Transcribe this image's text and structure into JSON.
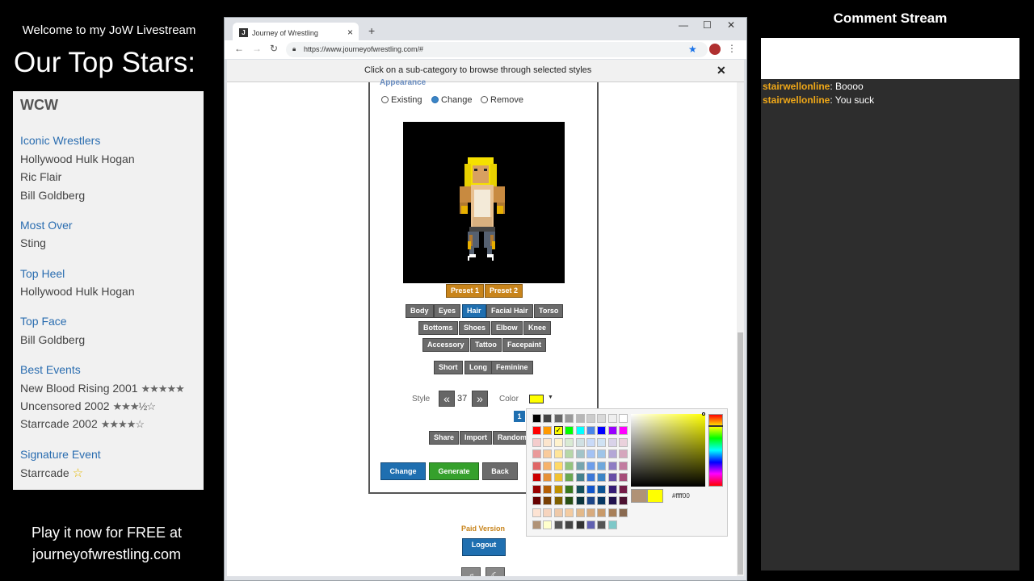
{
  "overlay": {
    "welcome": "Welcome to my JoW Livestream",
    "heading": "Our Top Stars:",
    "play_line1": "Play it now for FREE at",
    "play_line2": "journeyofwrestling.com"
  },
  "wcw": {
    "title": "WCW",
    "sections": [
      {
        "head": "Iconic Wrestlers",
        "items": [
          "Hollywood Hulk Hogan",
          "Ric Flair",
          "Bill Goldberg"
        ]
      },
      {
        "head": "Most Over",
        "items": [
          "Sting"
        ]
      },
      {
        "head": "Top Heel",
        "items": [
          "Hollywood Hulk Hogan"
        ]
      },
      {
        "head": "Top Face",
        "items": [
          "Bill Goldberg"
        ]
      },
      {
        "head": "Best Events",
        "items": [
          "New Blood Rising 2001",
          "Uncensored 2002",
          "Starrcade 2002"
        ],
        "ratings": [
          5,
          3.5,
          4
        ]
      },
      {
        "head": "Signature Event",
        "items": [
          "Starrcade"
        ]
      }
    ]
  },
  "browser": {
    "tab_title": "Journey of Wrestling",
    "favicon": "J",
    "url": "https://www.journeyofwrestling.com/#",
    "banner": "Click on a sub-category to browse through selected styles",
    "close_glyph": "✕"
  },
  "editor": {
    "section_cut": "Appearance",
    "radio": {
      "existing": "Existing",
      "change": "Change",
      "remove": "Remove",
      "selected": "change"
    },
    "presets": [
      "Preset 1",
      "Preset 2"
    ],
    "categories_row1": [
      "Body",
      "Eyes",
      "Hair",
      "Facial Hair",
      "Torso"
    ],
    "categories_row2": [
      "Bottoms",
      "Shoes",
      "Elbow",
      "Knee"
    ],
    "categories_row3": [
      "Accessory",
      "Tattoo",
      "Facepaint"
    ],
    "active_category": "Hair",
    "subcategories": [
      "Short",
      "Long",
      "Feminine"
    ],
    "style_label": "Style",
    "style_value": "37",
    "color_label": "Color",
    "color_value": "#ffff00",
    "page_number": "1",
    "actions": [
      "Share",
      "Import",
      "Randomi"
    ],
    "change_btn": "Change",
    "generate_btn": "Generate",
    "back_btn": "Back",
    "paid_version": "Paid Version",
    "logout": "Logout"
  },
  "picker": {
    "hex": "#ffff00",
    "selected_swatch": "#ffff00",
    "grays": [
      "#000000",
      "#434343",
      "#666666",
      "#999999",
      "#b7b7b7",
      "#cccccc",
      "#d9d9d9",
      "#efefef",
      "#ffffff"
    ],
    "brights": [
      "#ff0000",
      "#ff9900",
      "#ffff00",
      "#00ff00",
      "#00ffff",
      "#4a86e8",
      "#0000ff",
      "#9900ff",
      "#ff00ff"
    ],
    "shades": [
      [
        "#f4cccc",
        "#fce5cd",
        "#fff2cc",
        "#d9ead3",
        "#d0e0e3",
        "#c9daf8",
        "#cfe2f3",
        "#d9d2e9",
        "#ead1dc"
      ],
      [
        "#ea9999",
        "#f9cb9c",
        "#ffe599",
        "#b6d7a8",
        "#a2c4c9",
        "#a4c2f4",
        "#9fc5e8",
        "#b4a7d6",
        "#d5a6bd"
      ],
      [
        "#e06666",
        "#f6b26b",
        "#ffd966",
        "#93c47d",
        "#76a5af",
        "#6d9eeb",
        "#6fa8dc",
        "#8e7cc3",
        "#c27ba0"
      ],
      [
        "#cc0000",
        "#e69138",
        "#f1c232",
        "#6aa84f",
        "#45818e",
        "#3c78d8",
        "#3d85c6",
        "#674ea7",
        "#a64d79"
      ],
      [
        "#990000",
        "#b45f06",
        "#bf9000",
        "#38761d",
        "#134f5c",
        "#1155cc",
        "#0b5394",
        "#351c75",
        "#741b47"
      ],
      [
        "#660000",
        "#783f04",
        "#7f6000",
        "#274e13",
        "#0c343d",
        "#1c4587",
        "#073763",
        "#20124d",
        "#4c1130"
      ]
    ],
    "skin": [
      "#fde3d3",
      "#f6d4be",
      "#efc9a8",
      "#f4cba0",
      "#e3b98a",
      "#d8ab7e",
      "#c89a6a",
      "#a8805a",
      "#8a6a50"
    ],
    "extras": [
      "#b09276",
      "#ffffcc",
      "#555555",
      "#444444",
      "#333333",
      "#6060b0",
      "#555555",
      "#7ec8c8"
    ]
  },
  "comments": {
    "title": "Comment Stream",
    "items": [
      {
        "user": "stairwellonline",
        "text": ": Boooo"
      },
      {
        "user": "stairwellonline",
        "text": ": You suck"
      }
    ]
  }
}
